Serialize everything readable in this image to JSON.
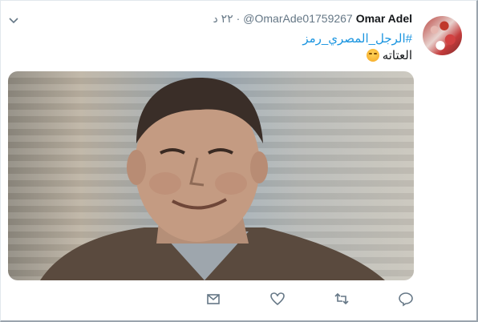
{
  "tweet": {
    "author_name": "Omar Adel",
    "author_handle": "@OmarAde01759267",
    "separator": "·",
    "time": "٢٢ د",
    "hashtag": "#الرجل_المصري_رمز",
    "text": "العتاته",
    "emoji": "face-with-tears-of-joy"
  },
  "actions": [
    {
      "icon": "mail-icon"
    },
    {
      "icon": "heart-icon"
    },
    {
      "icon": "retweet-icon"
    },
    {
      "icon": "reply-icon"
    }
  ],
  "colors": {
    "link": "#1b95e0",
    "muted": "#657786",
    "text": "#14171a",
    "border": "#e1e8ed"
  }
}
